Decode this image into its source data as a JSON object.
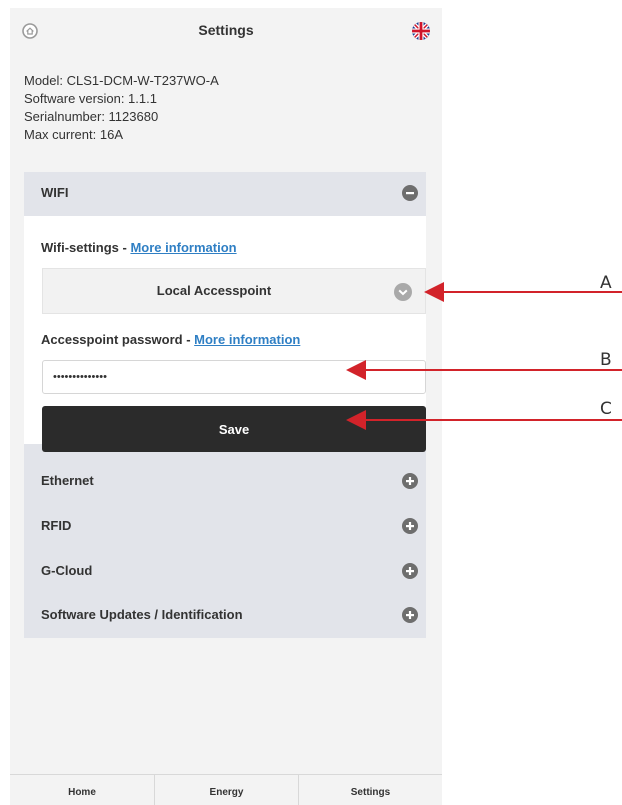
{
  "header": {
    "title": "Settings",
    "home_icon": "home-icon",
    "language_icon": "uk-flag-icon"
  },
  "device_info": {
    "model": "Model: CLS1-DCM-W-T237WO-A",
    "software_version": "Software version: 1.1.1",
    "serial_number": "Serialnumber: 1123680",
    "max_current": "Max current: 16A"
  },
  "sections": {
    "wifi": {
      "title": "WIFI",
      "state": "expanded",
      "toggle_icon": "minus-circle-icon"
    },
    "ethernet": {
      "title": "Ethernet",
      "state": "collapsed",
      "toggle_icon": "plus-circle-icon"
    },
    "rfid": {
      "title": "RFID",
      "state": "collapsed",
      "toggle_icon": "plus-circle-icon"
    },
    "gcloud": {
      "title": "G-Cloud",
      "state": "collapsed",
      "toggle_icon": "plus-circle-icon"
    },
    "updates": {
      "title": "Software Updates / Identification",
      "state": "collapsed",
      "toggle_icon": "plus-circle-icon"
    }
  },
  "wifi": {
    "settings_label": "Wifi-settings - ",
    "settings_link": "More information",
    "mode_selected": "Local Accesspoint",
    "password_label": "Accesspoint password - ",
    "password_link": "More information",
    "password_value": "••••••••••••••",
    "save_label": "Save"
  },
  "tabbar": {
    "items": [
      "Home",
      "Energy",
      "Settings"
    ]
  },
  "callouts": {
    "labels": [
      "A",
      "B",
      "C"
    ],
    "arrow_color": "#d2232a"
  },
  "colors": {
    "link": "#2f7fc4",
    "accordion_bg": "#e2e4ea",
    "save_button_bg": "#2b2b2b"
  }
}
